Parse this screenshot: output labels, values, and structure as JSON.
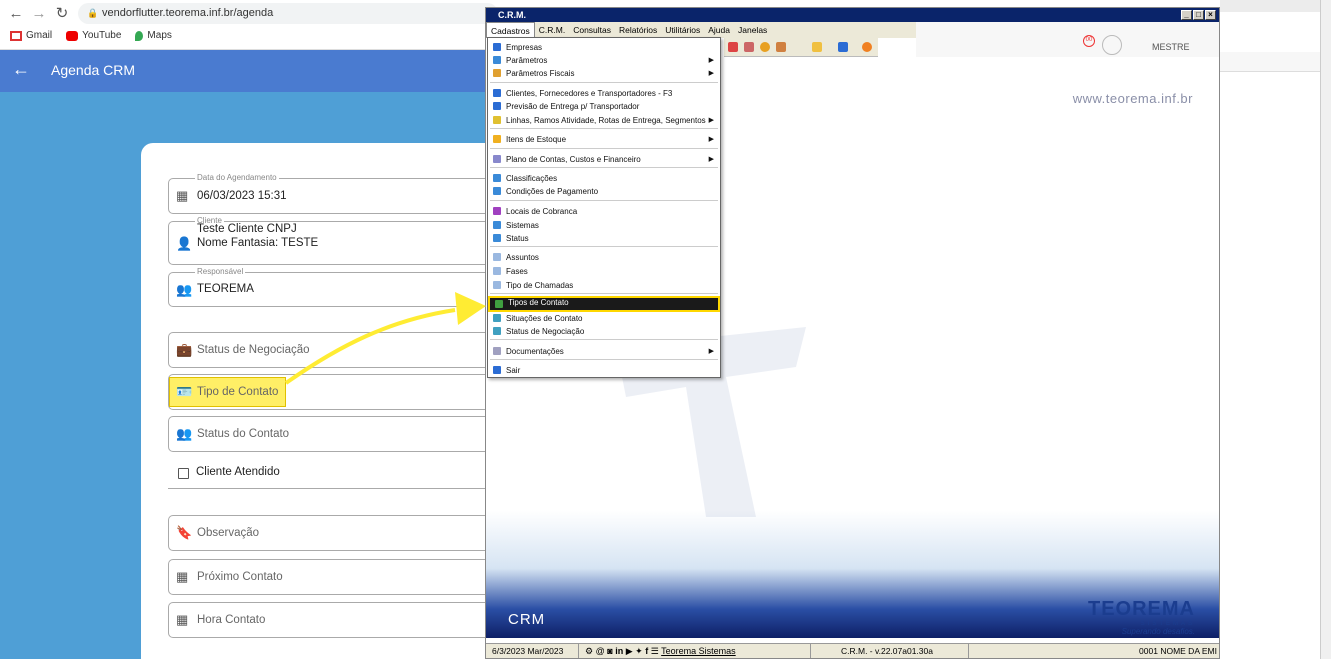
{
  "browser": {
    "url": "vendorflutter.teorema.inf.br/agenda",
    "bookmarks": [
      "Gmail",
      "YouTube",
      "Maps"
    ]
  },
  "app": {
    "title": "Agenda CRM",
    "form": {
      "data_label": "Data do Agendamento",
      "data_value": "06/03/2023 15:31",
      "cliente_label": "Cliente",
      "cliente_line1": "Teste Cliente CNPJ",
      "cliente_line2": "Nome Fantasia:  TESTE",
      "responsavel_label": "Responsável",
      "responsavel_value": "TEOREMA",
      "status_negociacao": "Status de Negociação",
      "tipo_contato": "Tipo de Contato",
      "status_contato": "Status do Contato",
      "cliente_atendido": "Cliente Atendido",
      "observacao": "Observação",
      "proximo_contato": "Próximo Contato",
      "hora_contato": "Hora Contato"
    }
  },
  "crm": {
    "window_title": "C.R.M.",
    "menu": [
      "Cadastros",
      "C.R.M.",
      "Consultas",
      "Relatórios",
      "Utilitários",
      "Ajuda",
      "Janelas"
    ],
    "user": "MESTRE",
    "notification_count": "00",
    "website": "www.teorema.inf.br",
    "crm_label": "CRM",
    "logo": "TEOREMA",
    "logo_sub": "SISTEMAS",
    "slogan": "Superando desafios.",
    "status": {
      "date": "6/3/2023 Mar/2023",
      "company_link": "Teorema Sistemas",
      "version": "C.R.M. - v.22.07a01.30a",
      "empresa": "0001 NOME DA EMI"
    },
    "dropdown": [
      {
        "label": "Empresas",
        "color": "#2b6cd4"
      },
      {
        "label": "Parâmetros",
        "color": "#3a8ad8",
        "sub": true
      },
      {
        "label": "Parâmetros Fiscais",
        "color": "#e0a030",
        "sub": true
      },
      {
        "label": "Clientes, Fornecedores e Transportadores - F3",
        "color": "#2b6cd4"
      },
      {
        "label": "Previsão de Entrega p/ Transportador",
        "color": "#2b6cd4"
      },
      {
        "label": "Linhas, Ramos Atividade, Rotas de Entrega, Segmentos",
        "color": "#e0c030",
        "sub": true
      },
      {
        "label": "Itens de Estoque",
        "color": "#f0b020",
        "sub": true
      },
      {
        "label": "Plano de Contas, Custos e Financeiro",
        "color": "#8888cc",
        "sub": true
      },
      {
        "label": "Classificações",
        "color": "#3a8ad8"
      },
      {
        "label": "Condições de Pagamento",
        "color": "#3a8ad8"
      },
      {
        "label": "Locais de Cobranca",
        "color": "#a040c0"
      },
      {
        "label": "Sistemas",
        "color": "#3a8ad8"
      },
      {
        "label": "Status",
        "color": "#3a8ad8"
      },
      {
        "label": "Assuntos",
        "color": "#9ab8e0"
      },
      {
        "label": "Fases",
        "color": "#9ab8e0"
      },
      {
        "label": "Tipo de Chamadas",
        "color": "#9ab8e0"
      },
      {
        "label": "Tipos de Contato",
        "color": "#40a040"
      },
      {
        "label": "Situações de Contato",
        "color": "#40a0c0"
      },
      {
        "label": "Status de Negociação",
        "color": "#40a0c0"
      },
      {
        "label": "Documentações",
        "color": "#a0a0c0",
        "sub": true
      },
      {
        "label": "Sair",
        "color": "#2b6cd4"
      }
    ]
  }
}
